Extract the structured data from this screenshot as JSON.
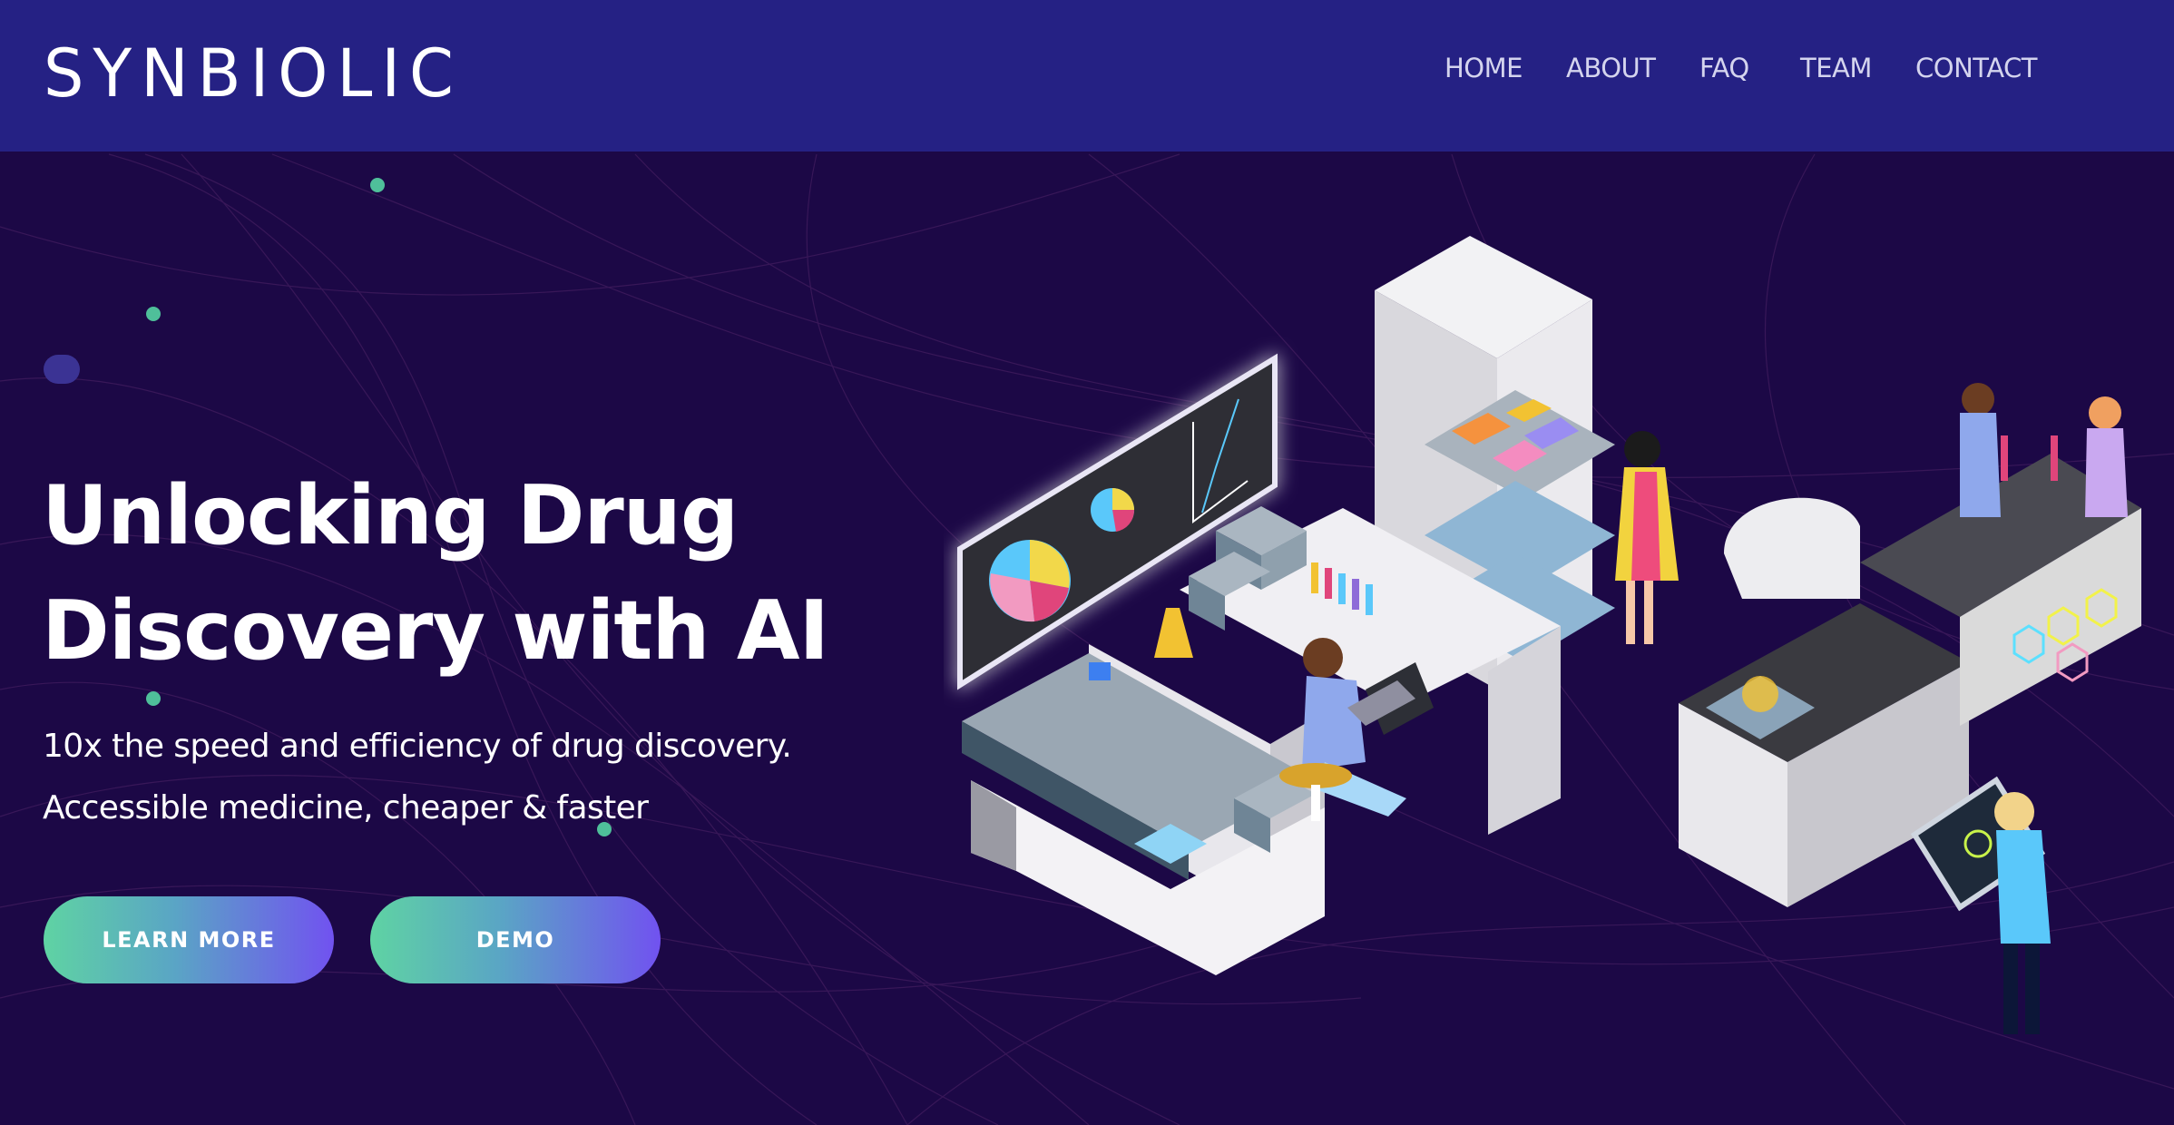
{
  "brand": {
    "logo_text": "SYNBIOLIC"
  },
  "nav": {
    "items": [
      {
        "label": "HOME"
      },
      {
        "label": "ABOUT"
      },
      {
        "label": "FAQ"
      },
      {
        "label": "TEAM"
      },
      {
        "label": "CONTACT"
      }
    ]
  },
  "hero": {
    "title_line1": "Unlocking Drug",
    "title_line2": "Discovery with AI",
    "subtitle_line1": "10x the speed and efficiency of drug discovery.",
    "subtitle_line2": "Accessible medicine, cheaper & faster",
    "learn_more_label": "LEARN MORE",
    "demo_label": "DEMO"
  },
  "colors": {
    "nav_background": "#252184",
    "page_background": "#1c0846",
    "button_gradient_start": "#5fd3a3",
    "button_gradient_end": "#7152f0",
    "decor_dot": "#4fbf9a"
  },
  "illustration": {
    "subject": "isometric-drug-discovery-lab"
  }
}
